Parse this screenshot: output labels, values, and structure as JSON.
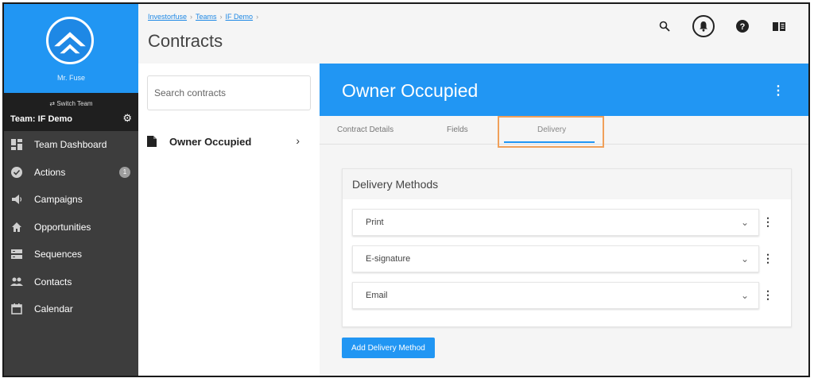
{
  "sidebar": {
    "user_name": "Mr. Fuse",
    "switch_team": "⇄ Switch Team",
    "team_name": "Team: IF Demo",
    "items": [
      {
        "label": "Team Dashboard",
        "icon": "dashboard-icon"
      },
      {
        "label": "Actions",
        "icon": "check-circle-icon",
        "badge": "1"
      },
      {
        "label": "Campaigns",
        "icon": "megaphone-icon"
      },
      {
        "label": "Opportunities",
        "icon": "home-icon"
      },
      {
        "label": "Sequences",
        "icon": "sequences-icon"
      },
      {
        "label": "Contacts",
        "icon": "people-icon"
      },
      {
        "label": "Calendar",
        "icon": "calendar-icon"
      }
    ]
  },
  "header": {
    "breadcrumb": [
      "Investorfuse",
      "Teams",
      "IF Demo"
    ],
    "breadcrumb_sep": "›",
    "title": "Contracts",
    "icons": [
      "search-icon",
      "bell-icon",
      "help-icon",
      "book-icon"
    ]
  },
  "list": {
    "search_placeholder": "Search contracts",
    "items": [
      {
        "label": "Owner Occupied",
        "chevron": "›"
      }
    ]
  },
  "detail": {
    "title": "Owner Occupied",
    "tabs": [
      "Contract Details",
      "Fields",
      "Delivery"
    ],
    "active_tab": "Delivery",
    "section_title": "Delivery Methods",
    "methods": [
      "Print",
      "E-signature",
      "Email"
    ],
    "add_button": "Add Delivery Method"
  },
  "colors": {
    "primary": "#2196f3",
    "sidebar_bg": "#3d3d3d",
    "highlight": "#f0a05a"
  }
}
